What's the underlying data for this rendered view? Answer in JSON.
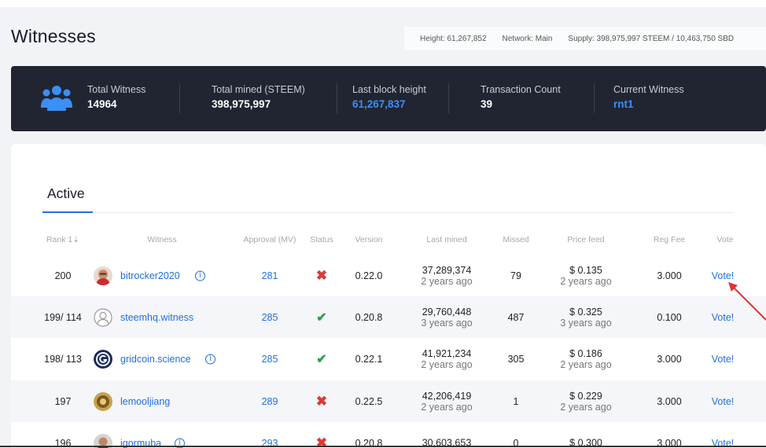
{
  "page": {
    "title": "Witnesses"
  },
  "network": {
    "height": "Height: 61,267,852",
    "network": "Network: Main",
    "supply": "Supply: 398,975,997 STEEM / 10,463,750 SBD"
  },
  "stats": {
    "icon": "users-icon",
    "items": [
      {
        "label": "Total Witness",
        "value": "14964"
      },
      {
        "label": "Total mined (STEEM)",
        "value": "398,975,997"
      },
      {
        "label": "Last block height",
        "value": "61,267,837"
      },
      {
        "label": "Transaction Count",
        "value": "39"
      },
      {
        "label": "Current Witness",
        "value": "rnt1"
      }
    ],
    "colors": {
      "panel": "#212532",
      "link": "#3b8ff5"
    }
  },
  "tabs": {
    "active": "Active"
  },
  "table": {
    "headers": [
      "Rank 1⇣",
      "Witness",
      "Approval (MV)",
      "Status",
      "Version",
      "Last mined",
      "Missed",
      "Price feed",
      "Reg Fee",
      "Vote"
    ],
    "rows": [
      {
        "rank": "200",
        "witness": "bitrocker2020",
        "approval": "281",
        "status": "disabled",
        "version": "0.22.0",
        "last_mined": "37,289,374",
        "last_mined_ago": "2 years ago",
        "missed": "79",
        "price": "$ 0.135",
        "price_ago": "2 years ago",
        "reg_fee": "3.000",
        "vote": "Vote!"
      },
      {
        "rank": "199/ 114",
        "witness": "steemhq.witness",
        "approval": "285",
        "status": "active",
        "version": "0.20.8",
        "last_mined": "29,760,448",
        "last_mined_ago": "3 years ago",
        "missed": "487",
        "price": "$ 0.325",
        "price_ago": "3 years ago",
        "reg_fee": "0.100",
        "vote": "Vote!"
      },
      {
        "rank": "198/ 113",
        "witness": "gridcoin.science",
        "approval": "285",
        "status": "active",
        "version": "0.22.1",
        "last_mined": "41,921,234",
        "last_mined_ago": "2 years ago",
        "missed": "305",
        "price": "$ 0.186",
        "price_ago": "2 years ago",
        "reg_fee": "3.000",
        "vote": "Vote!"
      },
      {
        "rank": "197",
        "witness": "lemooljiang",
        "approval": "289",
        "status": "disabled",
        "version": "0.22.5",
        "last_mined": "42,206,419",
        "last_mined_ago": "2 years ago",
        "missed": "1",
        "price": "$ 0.229",
        "price_ago": "2 years ago",
        "reg_fee": "3.000",
        "vote": "Vote!"
      },
      {
        "rank": "196",
        "witness": "igormuba",
        "approval": "293",
        "status": "disabled",
        "version": "0.20.8",
        "last_mined": "30,603,653",
        "last_mined_ago": "",
        "missed": "0",
        "price": "$ 0.300",
        "price_ago": "",
        "reg_fee": "3.000",
        "vote": "Vote!"
      }
    ]
  }
}
